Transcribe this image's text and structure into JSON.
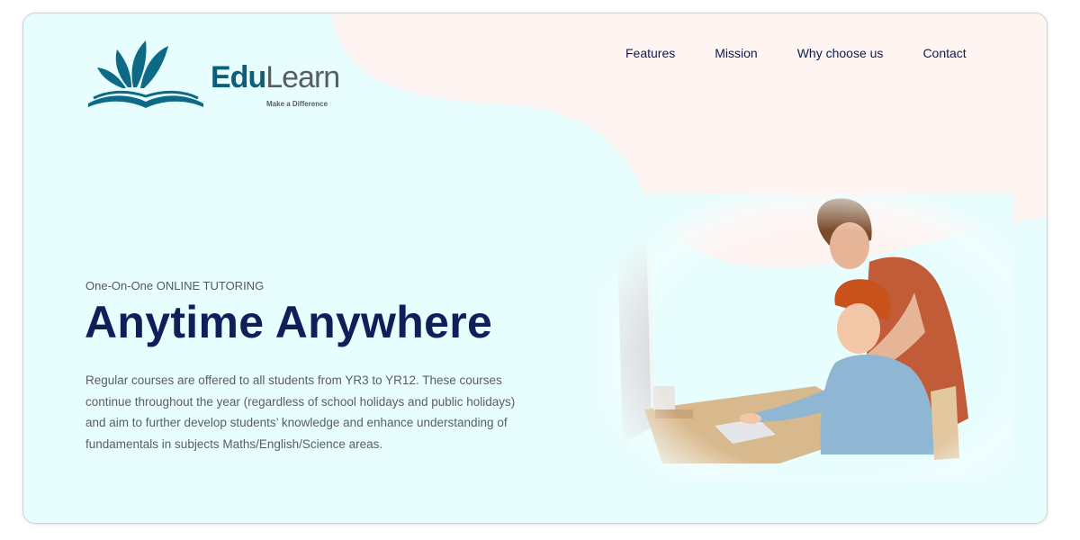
{
  "logo": {
    "name_part1": "Edu",
    "name_part2": "Learn",
    "tagline": "Make a Difference",
    "icon": "book-with-leaves-icon"
  },
  "nav": {
    "items": [
      {
        "label": "Features"
      },
      {
        "label": "Mission"
      },
      {
        "label": "Why choose us"
      },
      {
        "label": "Contact"
      }
    ]
  },
  "hero": {
    "eyebrow": "One-On-One ONLINE TUTORING",
    "headline": "Anytime Anywhere",
    "body": "Regular courses are offered to all students from YR3 to YR12. These courses continue throughout the year (regardless of school holidays and public holidays) and aim to further develop students’ knowledge and enhance understanding of fundamentals in subjects Maths/English/Science areas.",
    "image": "mother-and-son-at-computer-photo"
  },
  "colors": {
    "background": "#e8fdfd",
    "blob": "#fef4f2",
    "headline": "#0f1f5a",
    "nav_text": "#0d1b4f",
    "brand_teal": "#0c5f7b",
    "brand_gray": "#585d60"
  }
}
